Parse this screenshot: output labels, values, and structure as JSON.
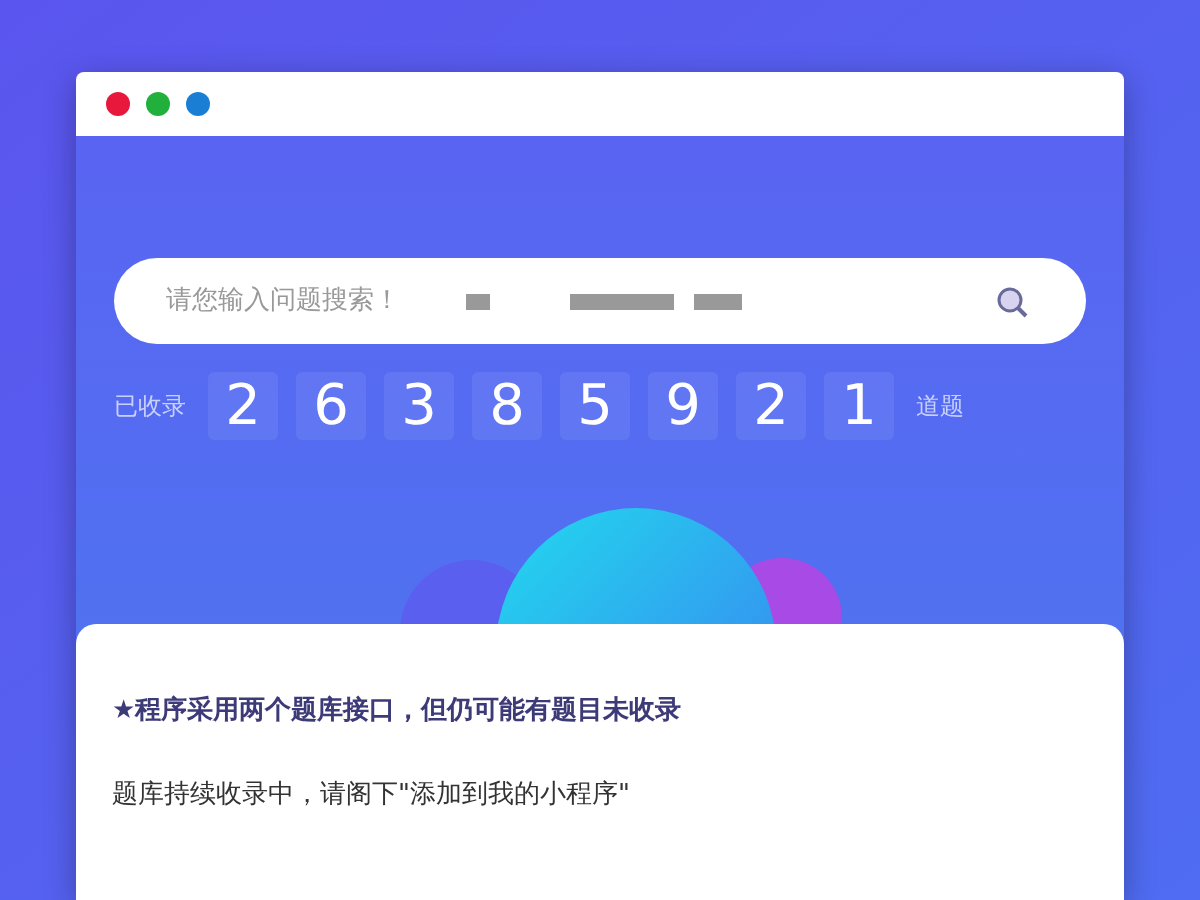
{
  "window_controls": [
    {
      "color": "#e8173c"
    },
    {
      "color": "#22b03c"
    },
    {
      "color": "#1a7fd4"
    }
  ],
  "search": {
    "placeholder": "请您输入问题搜索！"
  },
  "counter": {
    "prefix": "已收录",
    "digits": [
      "2",
      "6",
      "3",
      "8",
      "5",
      "9",
      "2",
      "1"
    ],
    "suffix": "道题"
  },
  "notice": {
    "lines": [
      {
        "kind": "highlight",
        "text": "★程序采用两个题库接口，但仍可能有题目未收录"
      },
      {
        "kind": "plain",
        "text": "题库持续收录中，请阁下\"添加到我的小程序\""
      }
    ]
  }
}
